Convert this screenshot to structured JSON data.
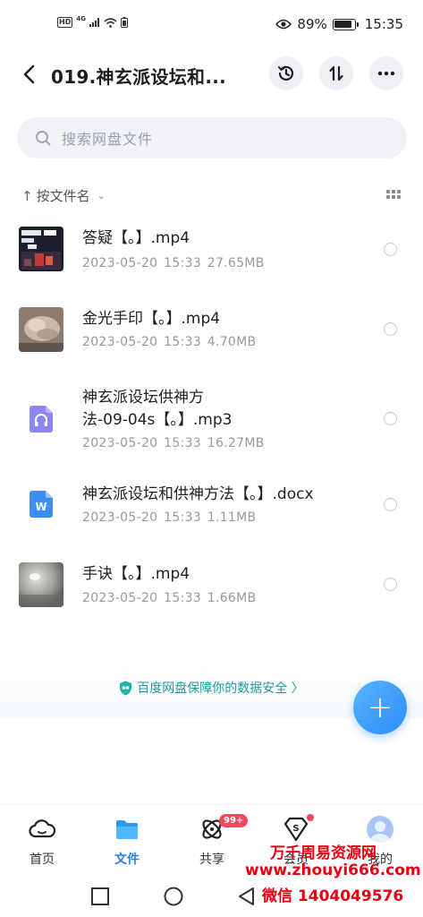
{
  "status_bar": {
    "network": "4G",
    "hd_label": "HD",
    "battery_percent": "89%",
    "battery_level": 0.89,
    "time": "15:35"
  },
  "header": {
    "title": "019.神玄派设坛和...",
    "icons": [
      "back-arrow-icon",
      "history-icon",
      "sort-icon",
      "more-icon"
    ]
  },
  "search": {
    "placeholder": "搜索网盘文件"
  },
  "sort": {
    "label": "按文件名"
  },
  "files": [
    {
      "name": "答疑【。】.mp4",
      "date": "2023-05-20",
      "time": "15:33",
      "size": "27.65MB",
      "type": "video-thumb"
    },
    {
      "name": "金光手印【。】.mp4",
      "date": "2023-05-20",
      "time": "15:33",
      "size": "4.70MB",
      "type": "video-thumb"
    },
    {
      "name": "神玄派设坛供神方法-09-04s【。】.mp3",
      "name_line1": "神玄派设坛供神方",
      "name_line2": "法-09-04s【。】.mp3",
      "date": "2023-05-20",
      "time": "15:33",
      "size": "16.27MB",
      "type": "audio"
    },
    {
      "name": "神玄派设坛和供神方法【。】.docx",
      "date": "2023-05-20",
      "time": "15:33",
      "size": "1.11MB",
      "type": "word"
    },
    {
      "name": "手诀【。】.mp4",
      "date": "2023-05-20",
      "time": "15:33",
      "size": "1.66MB",
      "type": "video-thumb"
    }
  ],
  "security_note": "百度网盘保障你的数据安全 〉",
  "fab_label": "+",
  "bottom_nav": [
    {
      "label": "首页",
      "icon": "cloud-icon",
      "active": false
    },
    {
      "label": "文件",
      "icon": "folder-icon",
      "active": true
    },
    {
      "label": "共享",
      "icon": "share-icon",
      "active": false,
      "badge": "99+"
    },
    {
      "label": "会员",
      "icon": "vip-icon",
      "active": false,
      "dot": true
    },
    {
      "label": "我的",
      "icon": "avatar-icon",
      "active": false
    }
  ],
  "watermark": {
    "line1": "万千周易资源网",
    "line2": "www.zhouyi666.com",
    "line3": "微信 1404049576"
  },
  "colors": {
    "accent": "#2b7ef5",
    "fab": "#3a9bf7",
    "safe_text": "#1e9b9e",
    "badge": "#f0495e",
    "watermark": "#e60012"
  }
}
